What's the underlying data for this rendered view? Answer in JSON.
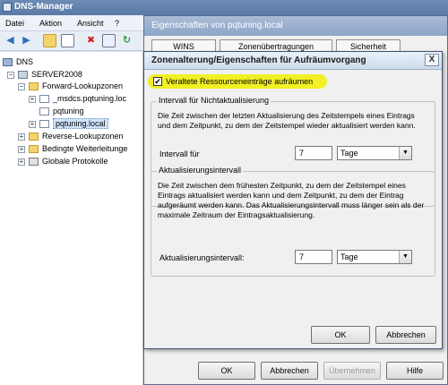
{
  "app": {
    "title": "DNS-Manager"
  },
  "menu": [
    "Datei",
    "Aktion",
    "Ansicht",
    "?"
  ],
  "toolbar": {
    "icons": [
      "back-arrow-icon",
      "forward-arrow-icon",
      "up-folder-icon",
      "show-hide-tree-icon",
      "delete-icon",
      "properties-icon",
      "refresh-icon"
    ]
  },
  "tree": {
    "root": "DNS",
    "server": "SERVER2008",
    "forward_zones": "Forward-Lookupzonen",
    "zones": [
      "_msdcs.pqtuning.loc",
      "pqtuning",
      "pqtuning.local"
    ],
    "reverse_zones": "Reverse-Lookupzonen",
    "conditional_forwarders": "Bedingte Weiterleitunge",
    "global_logs": "Globale Protokolle"
  },
  "properties": {
    "title": "Eigenschaften von pqtuning.local",
    "tabs": [
      "WINS",
      "Zonenübertragungen",
      "Sicherheit"
    ],
    "buttons": {
      "ok": "OK",
      "cancel": "Abbrechen",
      "apply": "Übernehmen",
      "help": "Hilfe"
    }
  },
  "dialog": {
    "title": "Zonenalterung/Eigenschaften für Aufräumvorgang",
    "close": "X",
    "scavenge_checkbox": {
      "label": "Veraltete Ressourceneinträge aufräumen",
      "checked": true,
      "mark": "✔"
    },
    "norefresh": {
      "title": "Intervall für Nichtaktualisierung",
      "description": "Die Zeit zwischen der letzten Aktualisierung des Zeitstempels eines Eintrags und dem Zeitpunkt, zu dem der Zeitstempel wieder aktualisiert werden kann.",
      "field_label": "Intervall für",
      "value": "7",
      "unit": "Tage"
    },
    "refresh": {
      "title": "Aktualisierungsintervall",
      "description": "Die Zeit zwischen dem frühesten Zeitpunkt, zu dem der Zeitstempel eines Eintrags aktualisiert werden kann und dem Zeitpunkt, zu dem der Eintrag aufgeräumt werden kann. Das Aktualisierungsintervall muss länger sein als der maximale Zeitraum der Eintragsaktualisierung.",
      "field_label": "Aktualisierungsintervall:",
      "value": "7",
      "unit": "Tage"
    },
    "buttons": {
      "ok": "OK",
      "cancel": "Abbrechen"
    },
    "dropdown_arrow": "▼"
  }
}
